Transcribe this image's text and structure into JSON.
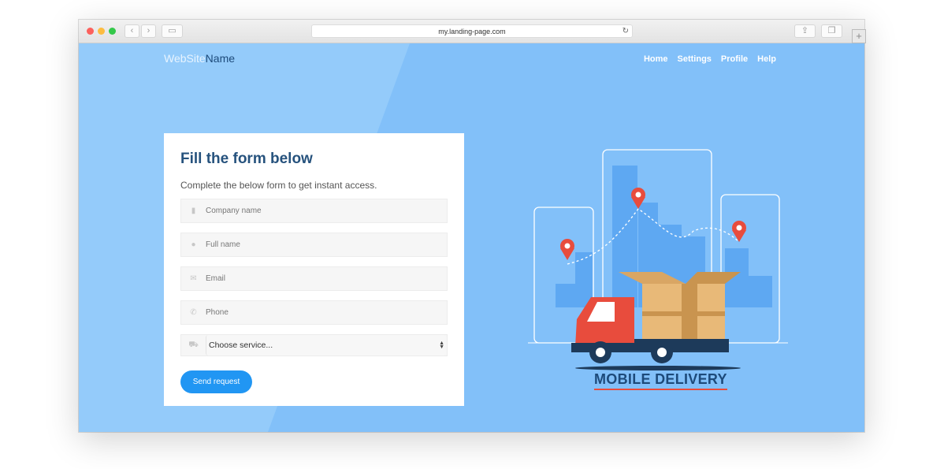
{
  "browser": {
    "url": "my.landing-page.com"
  },
  "site": {
    "logo_part1": "WebSite",
    "logo_part2": "Name",
    "nav": [
      "Home",
      "Settings",
      "Profile",
      "Help"
    ]
  },
  "form": {
    "title": "Fill the form below",
    "subtitle": "Complete the below form to get instant access.",
    "fields": [
      {
        "placeholder": "Company name",
        "icon": "building-icon"
      },
      {
        "placeholder": "Full name",
        "icon": "user-icon"
      },
      {
        "placeholder": "Email",
        "icon": "envelope-icon"
      },
      {
        "placeholder": "Phone",
        "icon": "phone-icon"
      }
    ],
    "service_select": {
      "value": "Choose service...",
      "icon": "truck-icon"
    },
    "submit_label": "Send request"
  },
  "illustration": {
    "caption": "MOBILE DELIVERY"
  },
  "colors": {
    "background": "#82c0f9",
    "title": "#26527d",
    "button": "#2196f3",
    "accent_red": "#e84c3d"
  }
}
